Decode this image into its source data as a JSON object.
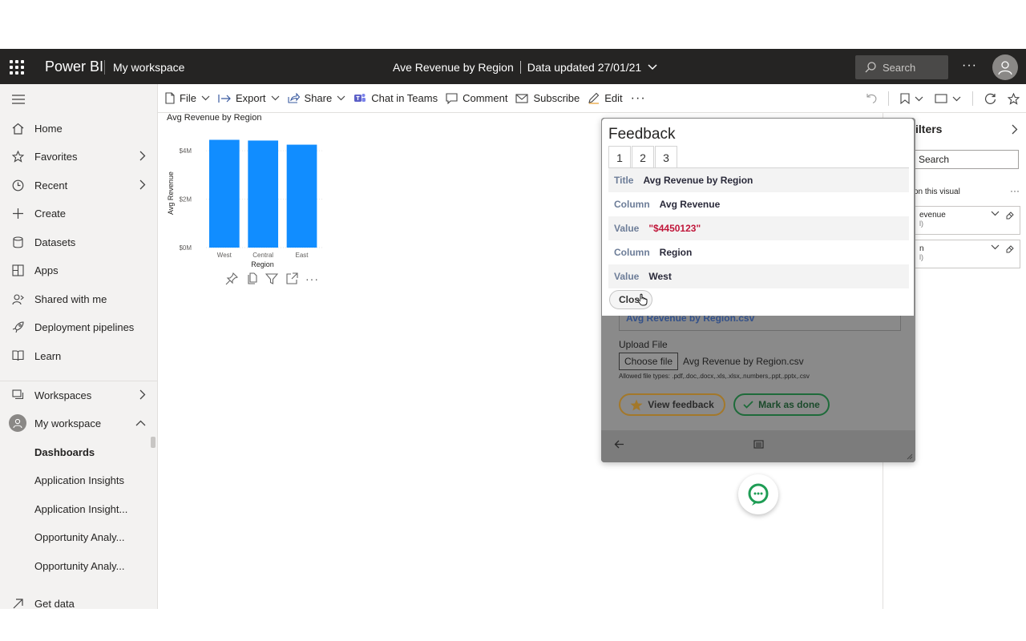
{
  "app": {
    "brand": "Power BI",
    "workspace": "My workspace",
    "report_title": "Ave Revenue by Region",
    "data_updated": "Data updated 27/01/21",
    "search_placeholder": "Search"
  },
  "toolbar": {
    "file": "File",
    "export": "Export",
    "share": "Share",
    "chat_in_teams": "Chat in Teams",
    "comment": "Comment",
    "subscribe": "Subscribe",
    "edit": "Edit"
  },
  "nav": {
    "items": [
      {
        "label": "Home",
        "icon": "home-icon"
      },
      {
        "label": "Favorites",
        "icon": "star-icon"
      },
      {
        "label": "Recent",
        "icon": "clock-icon"
      },
      {
        "label": "Create",
        "icon": "plus-icon"
      },
      {
        "label": "Datasets",
        "icon": "database-icon"
      },
      {
        "label": "Apps",
        "icon": "apps-icon"
      },
      {
        "label": "Shared with me",
        "icon": "person-share-icon"
      },
      {
        "label": "Deployment pipelines",
        "icon": "rocket-icon"
      },
      {
        "label": "Learn",
        "icon": "book-icon"
      }
    ],
    "workspaces": "Workspaces",
    "my_workspace": "My workspace",
    "sub_items": [
      "Dashboards",
      "Application Insights",
      "Application Insight...",
      "Opportunity Analy...",
      "Opportunity Analy..."
    ],
    "get_data": "Get data"
  },
  "chart_data": {
    "type": "bar",
    "title": "Avg Revenue by Region",
    "categories": [
      "West",
      "Central",
      "East"
    ],
    "values": [
      4450123,
      4420000,
      4250000
    ],
    "xlabel": "Region",
    "ylabel": "Avg Revenue",
    "ylim": [
      0,
      4500000
    ],
    "ytick_labels": [
      "$0M",
      "$2M",
      "$4M"
    ],
    "ytick_values": [
      0,
      2000000,
      4000000
    ],
    "bar_color": "#118dff",
    "grid": true
  },
  "filters": {
    "title": "ilters",
    "search": "Search",
    "subheading": "on this visual",
    "cards": [
      {
        "label": "evenue",
        "sub": "l)"
      },
      {
        "label": "n",
        "sub": "l)"
      }
    ]
  },
  "feedback": {
    "title": "Feedback",
    "tabs": [
      "1",
      "2",
      "3"
    ],
    "rows": [
      {
        "key": "Title",
        "value": "Avg Revenue by Region"
      },
      {
        "key": "Column",
        "value": "Avg Revenue"
      },
      {
        "key": "Value",
        "value": "\"$4450123\""
      },
      {
        "key": "Column",
        "value": "Region"
      },
      {
        "key": "Value",
        "value": "West"
      }
    ],
    "close_label": "Clos",
    "file_link": "Avg Revenue by Region.csv",
    "upload_label": "Upload File",
    "choose_file": "Choose file",
    "chosen_file": "Avg Revenue by Region.csv",
    "allowed_types": "Allowed file types: .pdf,.doc,.docx,.xls,.xlsx,.numbers,.ppt,.pptx,.csv",
    "view_feedback": "View feedback",
    "mark_as_done": "Mark as done",
    "accent_red": "#c0163a"
  }
}
